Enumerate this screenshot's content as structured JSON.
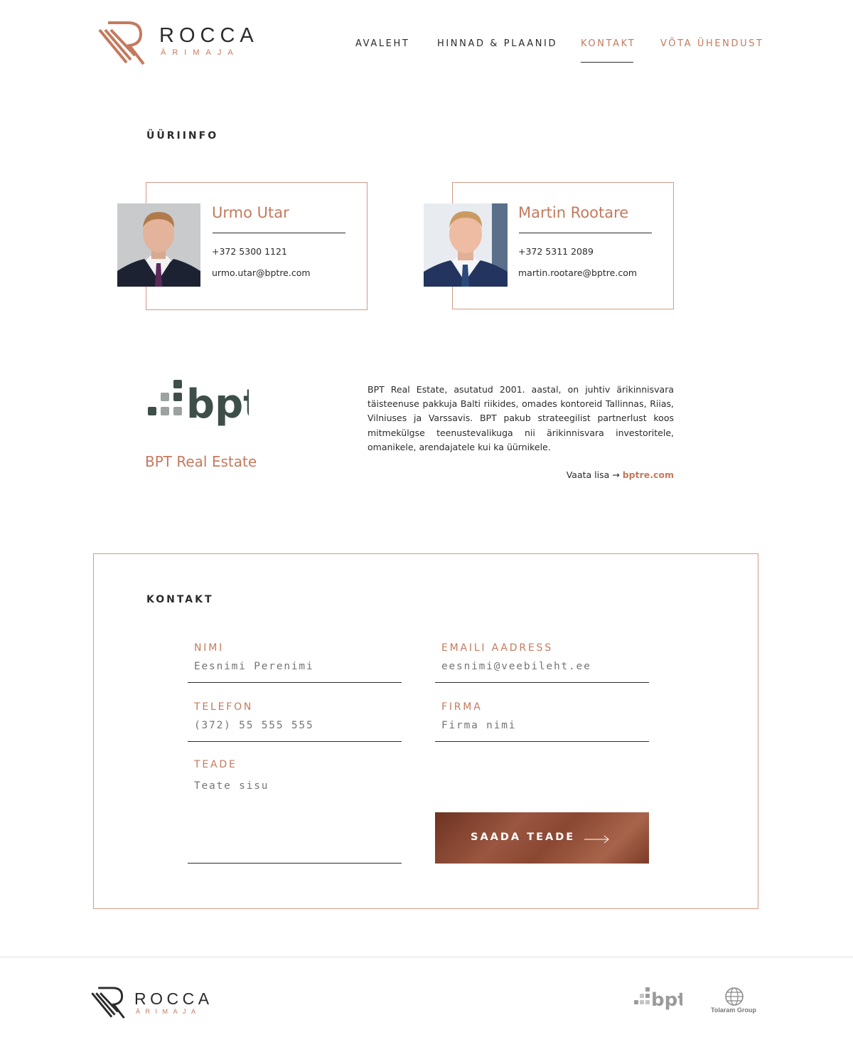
{
  "brand": {
    "name": "ROCCA",
    "sub": "ÄRIMAJA"
  },
  "nav": [
    {
      "label": "AVALEHT"
    },
    {
      "label": "HINNAD & PLAANID"
    },
    {
      "label": "KONTAKT"
    },
    {
      "label": "VÕTA ÜHENDUST"
    }
  ],
  "rental": {
    "title": "ÜÜRIINFO",
    "contacts": [
      {
        "name": "Urmo Utar",
        "phone": "+372 5300 1121",
        "email": "urmo.utar@bptre.com"
      },
      {
        "name": "Martin Rootare",
        "phone": "+372 5311 2089",
        "email": "martin.rootare@bptre.com"
      }
    ]
  },
  "bpt": {
    "logo_text": "bpt",
    "name": "BPT Real Estate",
    "description": "BPT Real Estate, asutatud 2001. aastal, on juhtiv ärikinnisvara täisteenuse pakkuja Balti riikides, omades kontoreid Tallinnas, Riias, Vilniuses ja Varssavis. BPT pakub strateegilist partnerlust koos mitmekülgse teenustevalikuga nii ärikinnisvara investoritele, omanikele, arendajatele kui ka üürnikele.",
    "more_label": "Vaata lisa →",
    "more_link": "bptre.com"
  },
  "contact_form": {
    "title": "KONTAKT",
    "fields": {
      "name": {
        "label": "NIMI",
        "placeholder": "Eesnimi Perenimi"
      },
      "email": {
        "label": "EMAILI AADRESS",
        "placeholder": "eesnimi@veebileht.ee"
      },
      "phone": {
        "label": "TELEFON",
        "placeholder": "(372) 55 555 555"
      },
      "company": {
        "label": "FIRMA",
        "placeholder": "Firma nimi"
      },
      "message": {
        "label": "TEADE",
        "placeholder": "Teate sisu"
      }
    },
    "submit_label": "SAADA TEADE"
  },
  "footer": {
    "brand": {
      "name": "ROCCA",
      "sub": "ÄRIMAJA"
    },
    "partners": [
      {
        "name": "bpt"
      },
      {
        "name": "Tolaram Group"
      }
    ]
  },
  "colors": {
    "accent": "#c47a5e",
    "text": "#2b2b2b",
    "bpt_green": "#3d4f48"
  }
}
